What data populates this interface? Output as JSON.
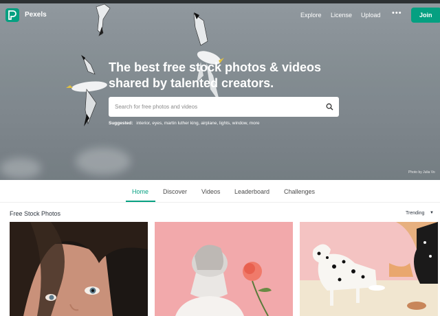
{
  "header": {
    "brand": "Pexels",
    "nav": [
      "Explore",
      "License",
      "Upload"
    ],
    "more_label": "•••",
    "join_label": "Join",
    "accent_color": "#05a081"
  },
  "hero": {
    "headline_line1": "The best free stock photos & videos",
    "headline_line2": "shared by talented creators.",
    "search_placeholder": "Search for free photos and videos",
    "suggested_label": "Suggested:",
    "suggestions": [
      "interior",
      "eyes",
      "martin luther king",
      "airplane",
      "lights",
      "window",
      "more"
    ],
    "credit": "Photo by Julia Vo"
  },
  "tabs": [
    "Home",
    "Discover",
    "Videos",
    "Leaderboard",
    "Challenges"
  ],
  "active_tab": "Home",
  "gallery": {
    "title": "Free Stock Photos",
    "sort_label": "Trending"
  },
  "icons": {
    "logo": "pexels-logo-icon",
    "search": "search-icon",
    "dropdown": "chevron-down-icon",
    "more": "more-dots-icon"
  }
}
